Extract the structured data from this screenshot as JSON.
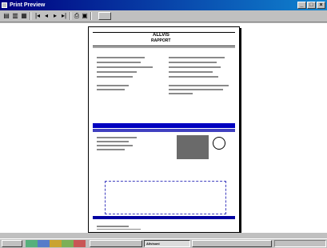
{
  "window": {
    "title": "Print Preview"
  },
  "toolbar": {
    "icons": [
      "page-up-icon",
      "page-down-icon",
      "zoom-icon",
      "first-icon",
      "prev-icon",
      "next-icon",
      "last-icon",
      "print-icon",
      "setup-icon",
      "export-icon"
    ],
    "close_label": ""
  },
  "report": {
    "title": "ALLVIS",
    "subtitle": "RAPPORT",
    "code": "",
    "left_header": "",
    "right_header": "",
    "section_left": "",
    "section_right": "",
    "footer_left": "",
    "footer_right": "",
    "symbol_row1": "",
    "symbol_row2": ""
  },
  "statusbar": {
    "text": ""
  },
  "taskbar": {
    "start": "",
    "tasks": [
      "",
      "",
      "Allvisoni",
      ""
    ],
    "clock": ""
  }
}
